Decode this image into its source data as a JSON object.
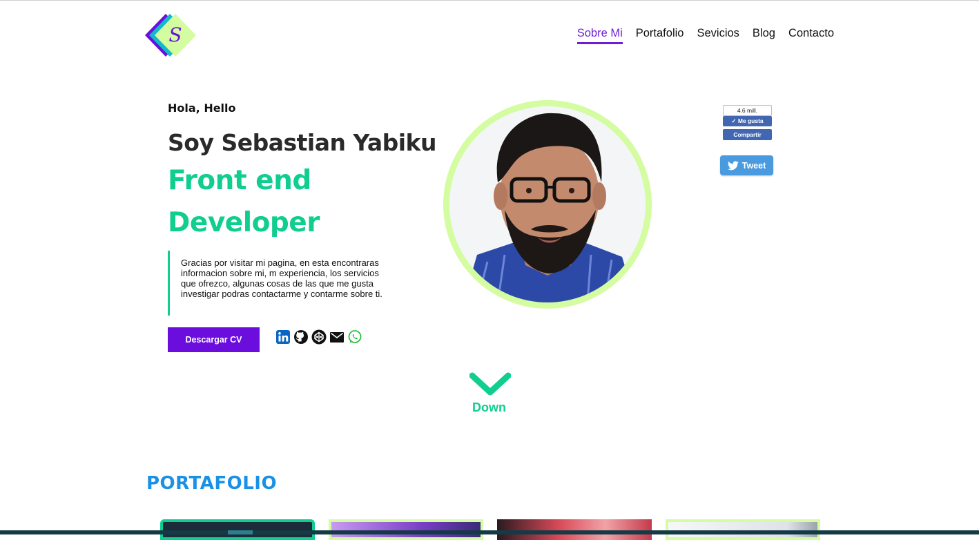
{
  "header": {
    "logo_letter": "S",
    "nav": [
      {
        "label": "Sobre Mi",
        "active": true
      },
      {
        "label": "Portafolio",
        "active": false
      },
      {
        "label": "Sevicios",
        "active": false
      },
      {
        "label": "Blog",
        "active": false
      },
      {
        "label": "Contacto",
        "active": false
      }
    ]
  },
  "hero": {
    "greeting": "Hola, Hello",
    "name": "Soy Sebastian Yabiku",
    "role_line1": "Front end",
    "role_line2": "Developer",
    "description": "Gracias por visitar mi pagina, en esta encontraras informacion sobre mi, m experiencia, los servicios que ofrezco, algunas cosas de las que me gusta investigar podras contactarme y contarme sobre ti.",
    "cv_button": "Descargar CV",
    "socials": [
      "linkedin-icon",
      "github-icon",
      "codepen-icon",
      "email-icon",
      "whatsapp-icon"
    ]
  },
  "share": {
    "fb_count": "4.6 mill.",
    "fb_like": "Me gusta",
    "fb_share": "Compartir",
    "tweet": "Tweet"
  },
  "down": {
    "label": "Down"
  },
  "portfolio": {
    "title": "PORTAFOLIO"
  },
  "colors": {
    "accent_purple": "#6a0ddd",
    "accent_green": "#0fce8f",
    "accent_lime": "#d4fca0",
    "heading_blue": "#1991e5"
  }
}
